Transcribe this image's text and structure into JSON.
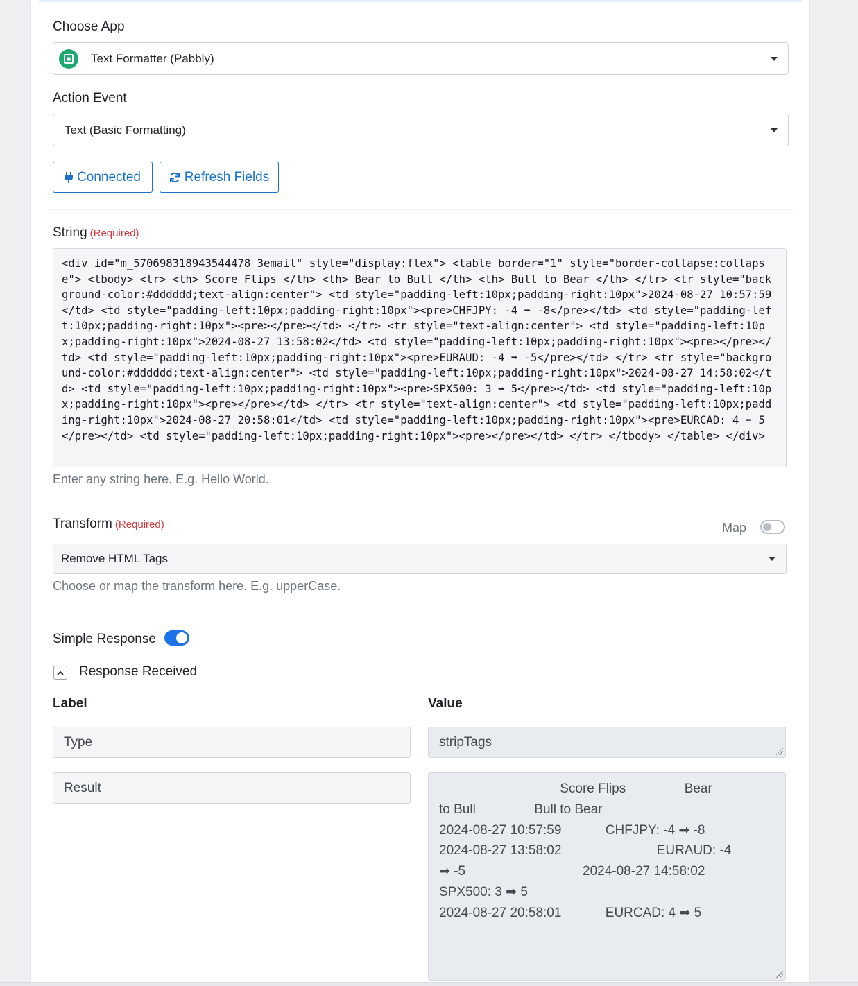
{
  "choose_app": {
    "label": "Choose App",
    "selected": "Text Formatter (Pabbly)"
  },
  "action_event": {
    "label": "Action Event",
    "selected": "Text (Basic Formatting)"
  },
  "buttons": {
    "connected": "Connected",
    "refresh": "Refresh Fields"
  },
  "string_field": {
    "label": "String",
    "required": "(Required)",
    "value": "<div id=\"m_570698318943544478 3email\" style=\"display:flex\"> <table border=\"1\" style=\"border-collapse:collapse\"> <tbody> <tr> <th> Score Flips </th> <th> Bear to Bull </th> <th> Bull to Bear </th> </tr> <tr style=\"background-color:#dddddd;text-align:center\"> <td style=\"padding-left:10px;padding-right:10px\">2024-08-27 10:57:59</td> <td style=\"padding-left:10px;padding-right:10px\"><pre>CHFJPY: -4 ➡ -8</pre></td> <td style=\"padding-left:10px;padding-right:10px\"><pre></pre></td> </tr> <tr style=\"text-align:center\"> <td style=\"padding-left:10px;padding-right:10px\">2024-08-27 13:58:02</td> <td style=\"padding-left:10px;padding-right:10px\"><pre></pre></td> <td style=\"padding-left:10px;padding-right:10px\"><pre>EURAUD: -4 ➡ -5</pre></td> </tr> <tr style=\"background-color:#dddddd;text-align:center\"> <td style=\"padding-left:10px;padding-right:10px\">2024-08-27 14:58:02</td> <td style=\"padding-left:10px;padding-right:10px\"><pre>SPX500: 3 ➡ 5</pre></td> <td style=\"padding-left:10px;padding-right:10px\"><pre></pre></td> </tr> <tr style=\"text-align:center\"> <td style=\"padding-left:10px;padding-right:10px\">2024-08-27 20:58:01</td> <td style=\"padding-left:10px;padding-right:10px\"><pre>EURCAD: 4 ➡ 5</pre></td> <td style=\"padding-left:10px;padding-right:10px\"><pre></pre></td> </tr> </tbody> </table> </div>",
    "hint": "Enter any string here. E.g. Hello World."
  },
  "transform_field": {
    "label": "Transform",
    "required": "(Required)",
    "map_label": "Map",
    "map_enabled": false,
    "selected": "Remove HTML Tags",
    "hint": "Choose or map the transform here. E.g. upperCase."
  },
  "simple_response": {
    "label": "Simple Response",
    "enabled": true
  },
  "response_received": {
    "label": "Response Received",
    "label_header": "Label",
    "value_header": "Value",
    "rows": [
      {
        "label": "Type",
        "value": "stripTags"
      },
      {
        "label": "Result",
        "value": "                                 Score Flips                Bear\nto Bull                Bull to Bear\n2024-08-27 10:57:59            CHFJPY: -4 ➡ -8\n2024-08-27 13:58:02                          EURAUD: -4\n➡ -5                                2024-08-27 14:58:02\nSPX500: 3 ➡ 5\n2024-08-27 20:58:01            EURCAD: 4 ➡ 5"
      }
    ]
  },
  "colors": {
    "accent": "#1a73c8",
    "toggle_on": "#1a73e8",
    "required": "#d0393e",
    "app_icon": "#1fa971"
  }
}
